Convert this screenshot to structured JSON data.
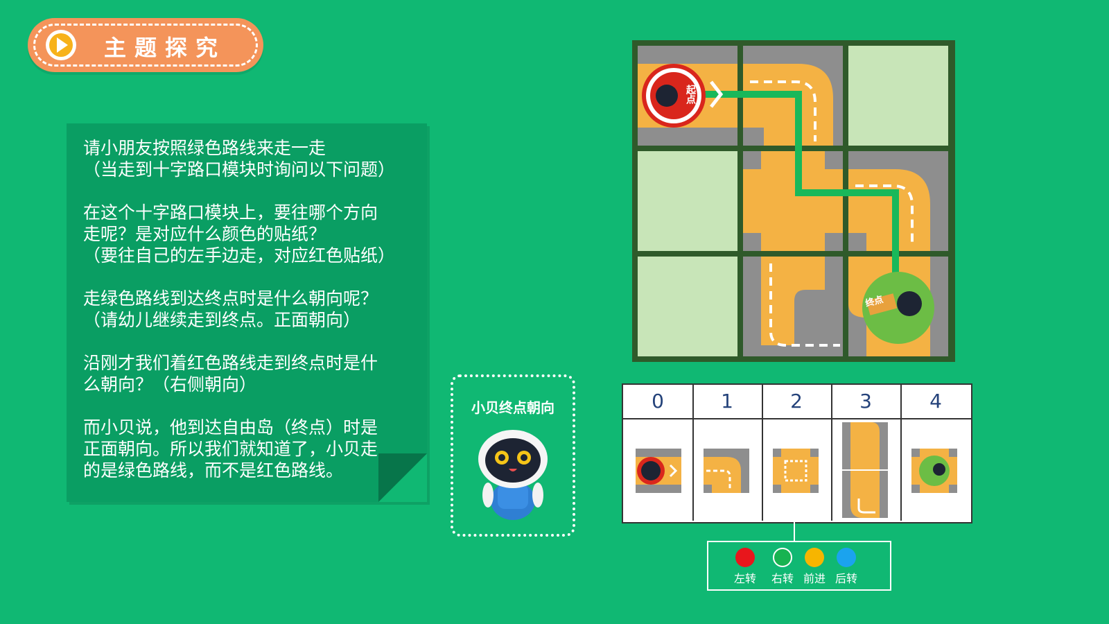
{
  "header": {
    "title": "主题探究"
  },
  "panel": {
    "paragraphs": [
      [
        "请小朋友按照绿色路线来走一走",
        "（当走到十字路口模块时询问以下问题）"
      ],
      [
        "在这个十字路口模块上，要往哪个方向",
        "走呢？是对应什么颜色的贴纸？",
        "（要往自己的左手边走，对应红色贴纸）"
      ],
      [
        "走绿色路线到达终点时是什么朝向呢？",
        "（请幼儿继续走到终点。正面朝向）"
      ],
      [
        "沿刚才我们着红色路线走到终点时是什",
        "么朝向？（右侧朝向）"
      ],
      [
        "而小贝说，他到达自由岛（终点）时是",
        "正面朝向。所以我们就知道了，小贝走",
        "的是绿色路线，而不是红色路线。"
      ]
    ]
  },
  "robot_box": {
    "caption": "小贝终点朝向"
  },
  "map": {
    "start_label": "起点",
    "end_label": "终点",
    "colors": {
      "road": "#f4b244",
      "ground": "#8e8e8e",
      "grass": "#c8e5b8",
      "route": "#19b85a",
      "border": "#2f5a2a"
    }
  },
  "table": {
    "headers": [
      "0",
      "1",
      "2",
      "3",
      "4"
    ]
  },
  "legend": {
    "items": [
      {
        "label": "左转",
        "color": "#e8161c"
      },
      {
        "label": "右转",
        "color": "#17b351"
      },
      {
        "label": "前进",
        "color": "#f7b500"
      },
      {
        "label": "后转",
        "color": "#1ba3ee"
      }
    ]
  }
}
